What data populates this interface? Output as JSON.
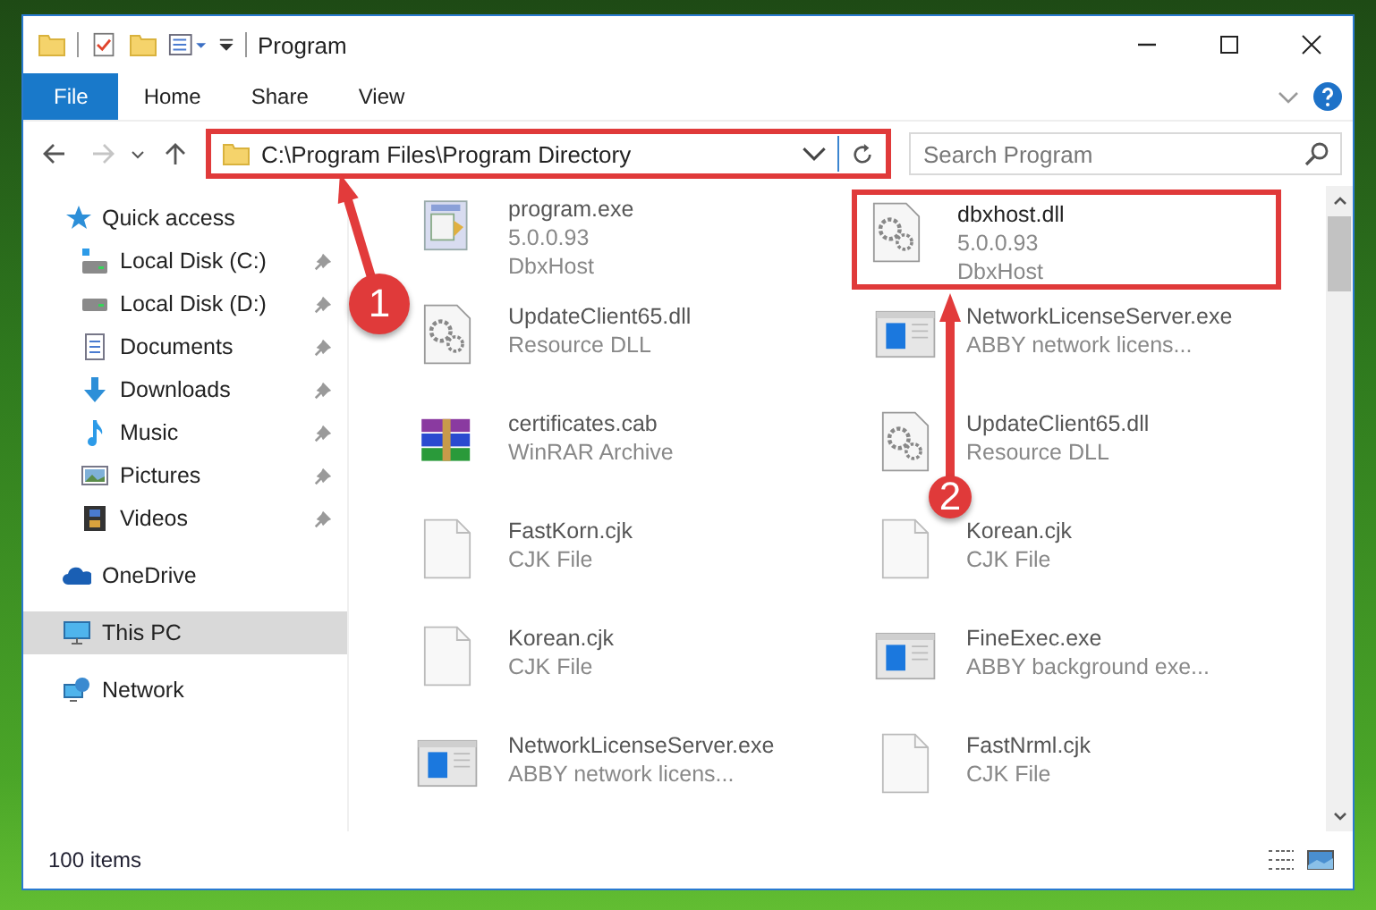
{
  "window": {
    "title": "Program"
  },
  "ribbon_tabs": [
    {
      "label": "File",
      "selected": true
    },
    {
      "label": "Home",
      "selected": false
    },
    {
      "label": "Share",
      "selected": false
    },
    {
      "label": "View",
      "selected": false
    }
  ],
  "address": {
    "path": "C:\\Program Files\\Program Directory",
    "highlighted": true
  },
  "search": {
    "placeholder": "Search Program"
  },
  "sidebar": {
    "items": [
      {
        "label": "Quick access",
        "selected": false,
        "children": [
          {
            "label": "Local Disk (C:)",
            "selected": false,
            "pinned": true
          },
          {
            "label": "Local Disk (D:)",
            "selected": false,
            "pinned": true
          },
          {
            "label": "Documents",
            "selected": false,
            "pinned": true
          },
          {
            "label": "Downloads",
            "selected": false,
            "pinned": true
          },
          {
            "label": "Music",
            "selected": false,
            "pinned": true
          },
          {
            "label": "Pictures",
            "selected": false,
            "pinned": true
          },
          {
            "label": "Videos",
            "selected": false,
            "pinned": true
          }
        ]
      },
      {
        "label": "OneDrive",
        "selected": false
      },
      {
        "label": "This PC",
        "selected": true
      },
      {
        "label": "Network",
        "selected": false
      }
    ]
  },
  "files": [
    {
      "name": "program.exe",
      "lines": [
        "5.0.0.93",
        "DbxHost"
      ],
      "highlighted": false
    },
    {
      "name": "dbxhost.dll",
      "lines": [
        "5.0.0.93",
        "DbxHost"
      ],
      "highlighted": true
    },
    {
      "name": "UpdateClient65.dll",
      "lines": [
        "Resource DLL"
      ],
      "highlighted": false
    },
    {
      "name": "NetworkLicenseServer.exe",
      "lines": [
        "ABBY network licens..."
      ],
      "highlighted": false
    },
    {
      "name": "certificates.cab",
      "lines": [
        "WinRAR Archive"
      ],
      "highlighted": false
    },
    {
      "name": "UpdateClient65.dll",
      "lines": [
        "Resource DLL"
      ],
      "highlighted": false
    },
    {
      "name": "FastKorn.cjk",
      "lines": [
        "CJK File"
      ],
      "highlighted": false
    },
    {
      "name": "Korean.cjk",
      "lines": [
        "CJK File"
      ],
      "highlighted": false
    },
    {
      "name": "Korean.cjk",
      "lines": [
        "CJK File"
      ],
      "highlighted": false
    },
    {
      "name": "FineExec.exe",
      "lines": [
        "ABBY background exe..."
      ],
      "highlighted": false
    },
    {
      "name": "NetworkLicenseServer.exe",
      "lines": [
        "ABBY network licens..."
      ],
      "highlighted": false
    },
    {
      "name": "FastNrml.cjk",
      "lines": [
        "CJK File"
      ],
      "highlighted": false
    }
  ],
  "status_bar": {
    "count": "100 items"
  },
  "annotations": [
    {
      "number": "1"
    },
    {
      "number": "2"
    }
  ]
}
